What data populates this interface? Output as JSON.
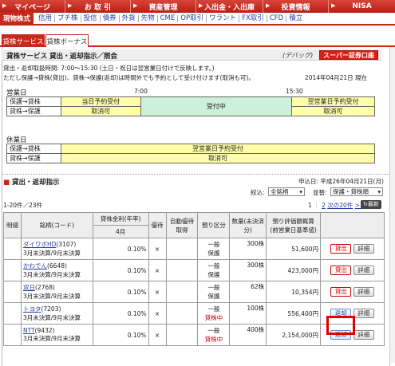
{
  "top_nav": {
    "items": [
      "マイページ",
      "お 取 引",
      "資産管理",
      "入出金・入出庫",
      "投資情報",
      "NISA"
    ]
  },
  "sub_nav": {
    "active": "現物株式",
    "items": [
      "信用",
      "プチ株",
      "投信",
      "債券",
      "外貨",
      "先物",
      "CME",
      "OP取引",
      "ワラント",
      "FX取引",
      "CFD",
      "積立"
    ]
  },
  "tabs": {
    "active": "貸株サービス",
    "inactive": "貸株ボーナス"
  },
  "title_bar": {
    "title": "貸株サービス 貸出・返却指示／照会",
    "debug_link": "(デバッグ)",
    "super_button": "スーパー証券口座"
  },
  "notes": {
    "line1": "貸出・返却取扱時間: 7:00～15:30 (土日・祝日は翌営業日付けで反映します。)",
    "line2": "ただし保護→貸株(貸出)、貸株→保護(返却)は時間外でも予約として受け付けます(取消も可)。",
    "date": "2014年04月21日 現在"
  },
  "business_day": {
    "label": "営業日",
    "time1": "7:00",
    "time2": "15:30",
    "row1_label": "保護→貸株",
    "row2_label": "貸株→保護",
    "prev_accept": "当日予約受付",
    "prev_cancel": "取消可",
    "middle": "受付中",
    "next_accept": "翌営業日予約受付",
    "next_cancel": "取消可"
  },
  "holiday": {
    "label": "休業日",
    "row1_label": "保護→貸株",
    "row2_label": "貸株→保護",
    "accept": "翌営業日予約受付",
    "cancel": "取消可"
  },
  "orders": {
    "section_title": "貸出・返却指示",
    "applied_date": "申込日: 平成26年04月21日(月)",
    "filter_label": "絞込:",
    "filter_value": "全銘柄",
    "sort_label": "並替:",
    "sort_value": "保護・貸株順",
    "count": "1-20件／23件",
    "pages": "1",
    "pages_sep": "2",
    "next_link": "次の20件",
    "next_arrow": ">>",
    "refresh": "最新"
  },
  "table": {
    "headers": {
      "detail": "明細",
      "stock": "銘柄(コード)",
      "rate": "貸株金利(年率)",
      "month": "4月",
      "priority": "優待",
      "auto_priority": "自動優待取得",
      "deposit": "預り区分",
      "qty": "数量(未決済分)",
      "valuation": "預り評価額概算(前営業日基準値)"
    },
    "rows": [
      {
        "name": "ダイワボHD",
        "code": "(3107)",
        "settle": "3月末決算/9月末決算",
        "rate": "0.10%",
        "priority": "×",
        "deposit1": "一般",
        "deposit2": "保護",
        "qty": "300株",
        "val": "51,600円",
        "btn1": "貸出",
        "btn2": "詳細",
        "btn1_type": "red"
      },
      {
        "name": "かわでん",
        "code": "(6648)",
        "settle": "3月末決算/9月末決算",
        "rate": "0.10%",
        "priority": "×",
        "deposit1": "一般",
        "deposit2": "保護",
        "qty": "300株",
        "val": "423,000円",
        "btn1": "貸出",
        "btn2": "詳細",
        "btn1_type": "red"
      },
      {
        "name": "双日",
        "code": "(2768)",
        "settle": "3月末決算/9月末決算",
        "rate": "0.10%",
        "priority": "×",
        "deposit1": "一般",
        "deposit2": "保護",
        "qty": "62株",
        "val": "10,354円",
        "btn1": "貸出",
        "btn2": "詳細",
        "btn1_type": "red"
      },
      {
        "name": "トヨタ",
        "code": "(7203)",
        "settle": "3月末決算/9月末決算",
        "rate": "0.10%",
        "priority": "×",
        "deposit1": "一般",
        "deposit2": "貸株中",
        "qty": "100株",
        "val": "556,400円",
        "btn1": "返却",
        "btn2": "詳細",
        "btn1_type": "blue"
      },
      {
        "name": "NTT",
        "code": "(9432)",
        "settle": "3月末決算/9月末決算",
        "rate": "0.10%",
        "priority": "×",
        "deposit1": "一般",
        "deposit2": "貸株中",
        "qty": "400株",
        "val": "2,154,000円",
        "btn1": "返却",
        "btn2": "詳細",
        "btn1_type": "blue"
      }
    ]
  }
}
